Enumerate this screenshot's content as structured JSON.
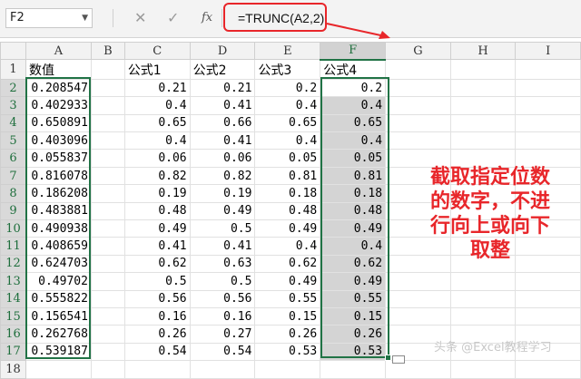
{
  "formula_bar": {
    "name_box": "F2",
    "cancel_icon": "✕",
    "confirm_icon": "✓",
    "fx_label": "fx",
    "formula": "=TRUNC(A2,2)"
  },
  "columns": [
    "A",
    "B",
    "C",
    "D",
    "E",
    "F",
    "G",
    "H",
    "I"
  ],
  "header_row": {
    "a": "数值",
    "b": "",
    "c": "公式1",
    "d": "公式2",
    "e": "公式3",
    "f": "公式4"
  },
  "rows": [
    {
      "n": "2",
      "a": "0.208547",
      "c": "0.21",
      "d": "0.21",
      "e": "0.2",
      "f": "0.2"
    },
    {
      "n": "3",
      "a": "0.402933",
      "c": "0.4",
      "d": "0.41",
      "e": "0.4",
      "f": "0.4"
    },
    {
      "n": "4",
      "a": "0.650891",
      "c": "0.65",
      "d": "0.66",
      "e": "0.65",
      "f": "0.65"
    },
    {
      "n": "5",
      "a": "0.403096",
      "c": "0.4",
      "d": "0.41",
      "e": "0.4",
      "f": "0.4"
    },
    {
      "n": "6",
      "a": "0.055837",
      "c": "0.06",
      "d": "0.06",
      "e": "0.05",
      "f": "0.05"
    },
    {
      "n": "7",
      "a": "0.816078",
      "c": "0.82",
      "d": "0.82",
      "e": "0.81",
      "f": "0.81"
    },
    {
      "n": "8",
      "a": "0.186208",
      "c": "0.19",
      "d": "0.19",
      "e": "0.18",
      "f": "0.18"
    },
    {
      "n": "9",
      "a": "0.483881",
      "c": "0.48",
      "d": "0.49",
      "e": "0.48",
      "f": "0.48"
    },
    {
      "n": "10",
      "a": "0.490938",
      "c": "0.49",
      "d": "0.5",
      "e": "0.49",
      "f": "0.49"
    },
    {
      "n": "11",
      "a": "0.408659",
      "c": "0.41",
      "d": "0.41",
      "e": "0.4",
      "f": "0.4"
    },
    {
      "n": "12",
      "a": "0.624703",
      "c": "0.62",
      "d": "0.63",
      "e": "0.62",
      "f": "0.62"
    },
    {
      "n": "13",
      "a": "0.49702",
      "c": "0.5",
      "d": "0.5",
      "e": "0.49",
      "f": "0.49"
    },
    {
      "n": "14",
      "a": "0.555822",
      "c": "0.56",
      "d": "0.56",
      "e": "0.55",
      "f": "0.55"
    },
    {
      "n": "15",
      "a": "0.156541",
      "c": "0.16",
      "d": "0.16",
      "e": "0.15",
      "f": "0.15"
    },
    {
      "n": "16",
      "a": "0.262768",
      "c": "0.26",
      "d": "0.27",
      "e": "0.26",
      "f": "0.26"
    },
    {
      "n": "17",
      "a": "0.539187",
      "c": "0.54",
      "d": "0.54",
      "e": "0.53",
      "f": "0.53"
    },
    {
      "n": "18",
      "a": "",
      "c": "",
      "d": "",
      "e": "",
      "f": ""
    }
  ],
  "annotation": {
    "lines": [
      "截取指定位数",
      "的数字，不进",
      "行向上或向下",
      "取整"
    ]
  },
  "watermark": "头条 @Excel教程学习",
  "colors": {
    "accent_green": "#217346",
    "callout_red": "#e8262a",
    "selection_gray": "#d4d4d4"
  }
}
